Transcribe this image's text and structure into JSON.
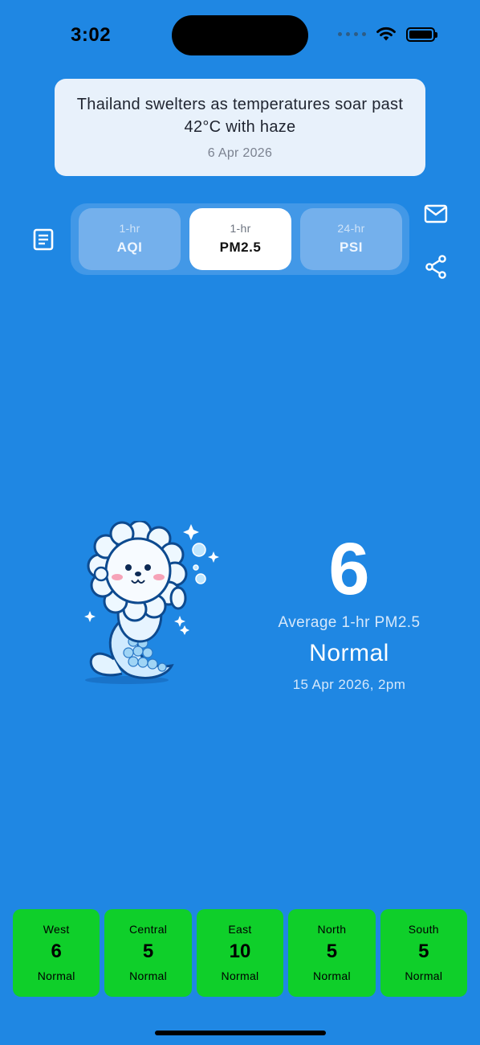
{
  "status_bar": {
    "time": "3:02"
  },
  "news": {
    "title": "Thailand swelters as temperatures soar past 42°C with haze",
    "date": "6 Apr 2026"
  },
  "icons": {
    "report": "report-icon",
    "mail": "mail-icon",
    "share": "share-icon",
    "wifi": "wifi-icon",
    "battery": "battery-icon",
    "signal": "signal-icon",
    "mascot": "merlion-mascot-icon"
  },
  "tabs": [
    {
      "sub": "1-hr",
      "label": "AQI",
      "active": false
    },
    {
      "sub": "1-hr",
      "label": "PM2.5",
      "active": true
    },
    {
      "sub": "24-hr",
      "label": "PSI",
      "active": false
    }
  ],
  "reading": {
    "value": "6",
    "label": "Average 1-hr PM2.5",
    "status": "Normal",
    "timestamp": "15 Apr 2026, 2pm"
  },
  "regions": [
    {
      "name": "West",
      "value": "6",
      "status": "Normal"
    },
    {
      "name": "Central",
      "value": "5",
      "status": "Normal"
    },
    {
      "name": "East",
      "value": "10",
      "status": "Normal"
    },
    {
      "name": "North",
      "value": "5",
      "status": "Normal"
    },
    {
      "name": "South",
      "value": "5",
      "status": "Normal"
    }
  ],
  "colors": {
    "background": "#1f87e3",
    "region_normal": "#0fcf2a",
    "card": "#e8f1fb"
  }
}
